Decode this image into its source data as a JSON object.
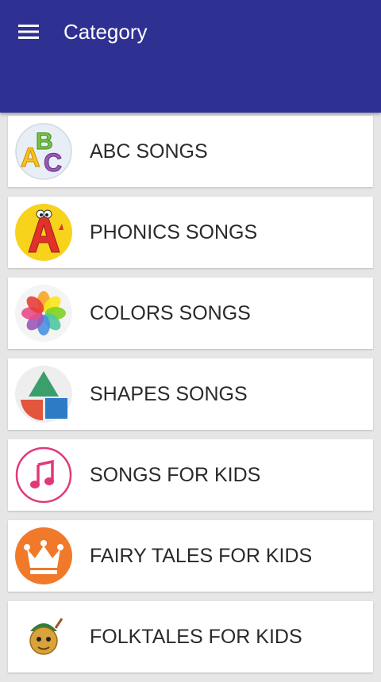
{
  "app_bar": {
    "title": "Category",
    "menu_icon": "hamburger-menu-icon",
    "color": "#2e3192"
  },
  "categories": [
    {
      "label": "ABC SONGS",
      "icon": "abc-letters-icon"
    },
    {
      "label": "PHONICS SONGS",
      "icon": "letter-a-character-icon"
    },
    {
      "label": "COLORS SONGS",
      "icon": "color-flower-icon"
    },
    {
      "label": "SHAPES SONGS",
      "icon": "shapes-icon"
    },
    {
      "label": "SONGS FOR KIDS",
      "icon": "music-note-icon"
    },
    {
      "label": "FAIRY TALES FOR KIDS",
      "icon": "crown-icon"
    },
    {
      "label": "FOLKTALES FOR KIDS",
      "icon": "folktale-character-icon"
    }
  ]
}
